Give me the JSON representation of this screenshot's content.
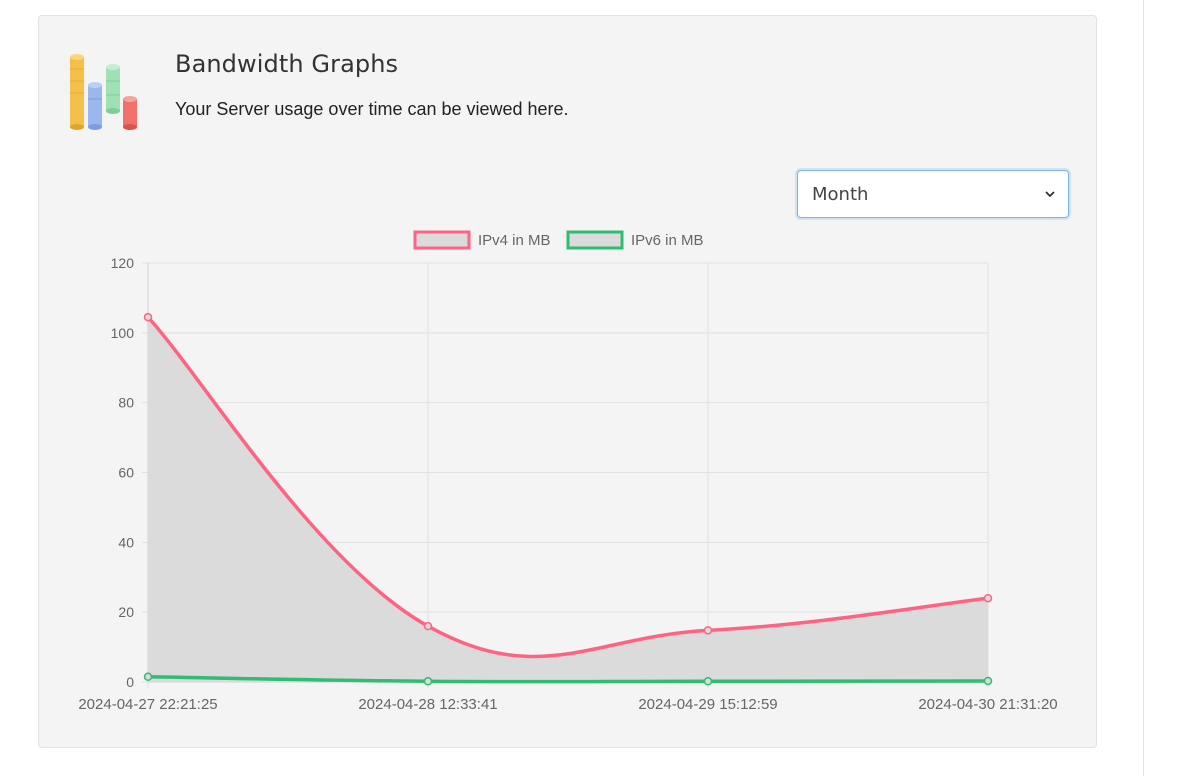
{
  "header": {
    "title": "Bandwidth Graphs",
    "subtitle": "Your Server usage over time can be viewed here."
  },
  "period_select": {
    "selected": "Month",
    "icon": "chevron-down-icon"
  },
  "logo": {
    "icon": "bar-chart-cylinders-icon"
  },
  "colors": {
    "ipv4": "#ff6384",
    "ipv6": "#2ebd73",
    "fill": "#dbdbdb",
    "grid": "#e1e1e1",
    "axis_text": "#666666"
  },
  "chart_data": {
    "type": "line",
    "categories": [
      "2024-04-27 22:21:25",
      "2024-04-28 12:33:41",
      "2024-04-29 15:12:59",
      "2024-04-30 21:31:20"
    ],
    "series": [
      {
        "name": "IPv4 in MB",
        "values": [
          104.5,
          16,
          14.8,
          24
        ]
      },
      {
        "name": "IPv6 in MB",
        "values": [
          1.5,
          0.2,
          0.2,
          0.3
        ]
      }
    ],
    "yticks": [
      "0",
      "20",
      "40",
      "60",
      "80",
      "100",
      "120"
    ],
    "ylim": [
      0,
      120
    ],
    "grid": true,
    "legend_position": "top"
  }
}
